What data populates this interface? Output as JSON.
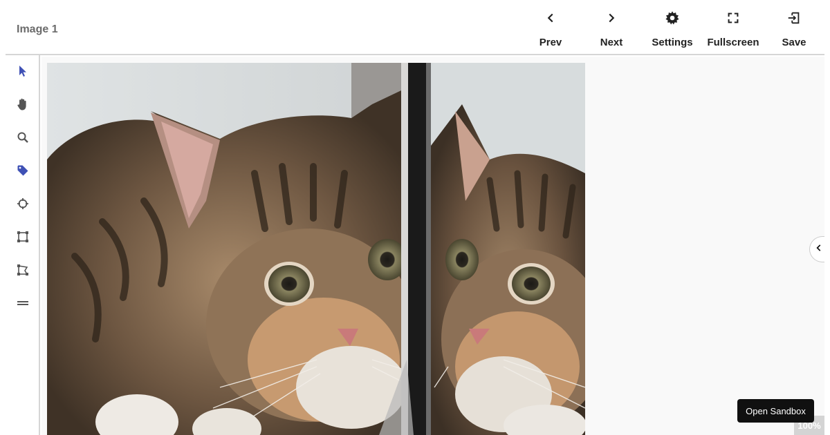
{
  "header": {
    "image_title": "Image 1",
    "toolbar": [
      {
        "label": "Prev",
        "icon": "chevron-left-icon"
      },
      {
        "label": "Next",
        "icon": "chevron-right-icon"
      },
      {
        "label": "Settings",
        "icon": "gear-icon"
      },
      {
        "label": "Fullscreen",
        "icon": "fullscreen-icon"
      },
      {
        "label": "Save",
        "icon": "save-exit-icon"
      }
    ]
  },
  "sidebar": {
    "tools": [
      {
        "name": "select",
        "icon": "cursor-arrow-icon",
        "active": true
      },
      {
        "name": "pan",
        "icon": "hand-icon",
        "active": false
      },
      {
        "name": "zoom",
        "icon": "magnifier-icon",
        "active": false
      },
      {
        "name": "label",
        "icon": "tag-icon",
        "active": true
      },
      {
        "name": "point",
        "icon": "crosshair-icon",
        "active": false
      },
      {
        "name": "bounding-box",
        "icon": "bounding-box-icon",
        "active": false
      },
      {
        "name": "polygon",
        "icon": "polygon-icon",
        "active": false
      },
      {
        "name": "line",
        "icon": "line-icon",
        "active": false
      }
    ],
    "active_color": "#3f51b5",
    "inactive_color": "#555555"
  },
  "canvas": {
    "zoom_label": "100%",
    "sandbox_label": "Open Sandbox"
  }
}
